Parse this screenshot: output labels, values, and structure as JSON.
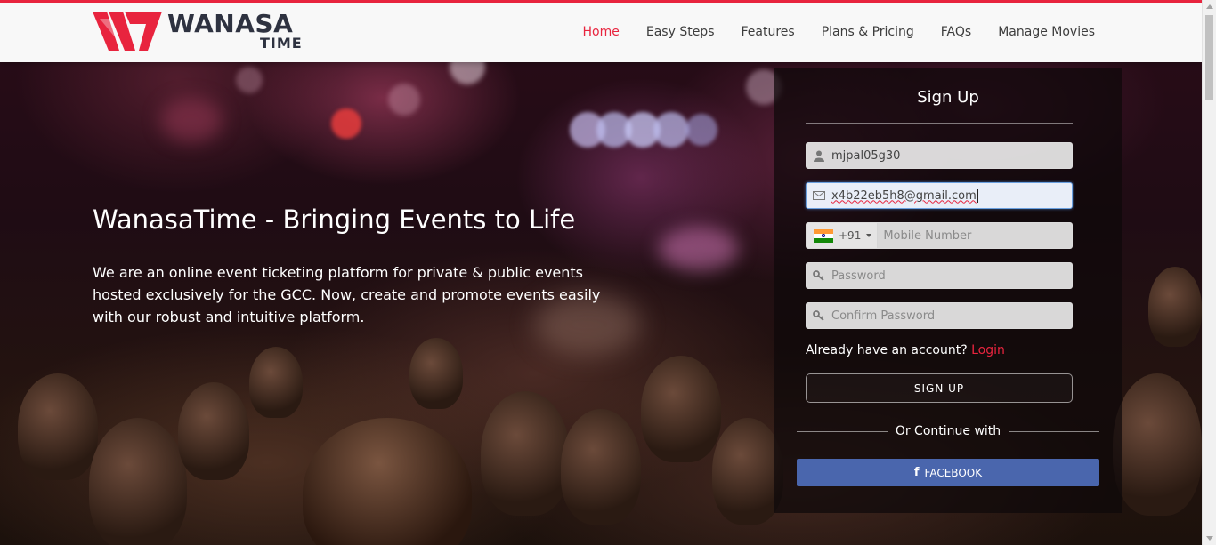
{
  "brand": {
    "name_line1": "WANASA",
    "name_line2": "TIME",
    "accent_color": "#e8243e",
    "text_color": "#2e3240"
  },
  "nav": {
    "items": [
      {
        "label": "Home",
        "active": true
      },
      {
        "label": "Easy Steps",
        "active": false
      },
      {
        "label": "Features",
        "active": false
      },
      {
        "label": "Plans & Pricing",
        "active": false
      },
      {
        "label": "FAQs",
        "active": false
      },
      {
        "label": "Manage Movies",
        "active": false
      }
    ]
  },
  "hero": {
    "title": "WanasaTime - Bringing Events to Life",
    "description": "We are an online event ticketing platform for private & public events hosted exclusively for the GCC. Now, create and promote events easily with our robust and intuitive platform."
  },
  "signup": {
    "title": "Sign Up",
    "username": {
      "value": "mjpal05g30",
      "icon": "user-icon"
    },
    "email": {
      "value": "x4b22eb5h8@gmail.com",
      "icon": "envelope-icon"
    },
    "phone": {
      "country_flag": "india-flag-icon",
      "dial_code": "+91",
      "placeholder": "Mobile Number"
    },
    "password": {
      "placeholder": "Password",
      "icon": "key-icon"
    },
    "confirm_password": {
      "placeholder": "Confirm Password",
      "icon": "key-icon"
    },
    "account_prompt": "Already have an account?",
    "login_link": "Login",
    "submit_label": "SIGN UP",
    "divider_text": "Or Continue with",
    "facebook_label": "FACEBOOK",
    "facebook_color": "#4a66ad"
  }
}
